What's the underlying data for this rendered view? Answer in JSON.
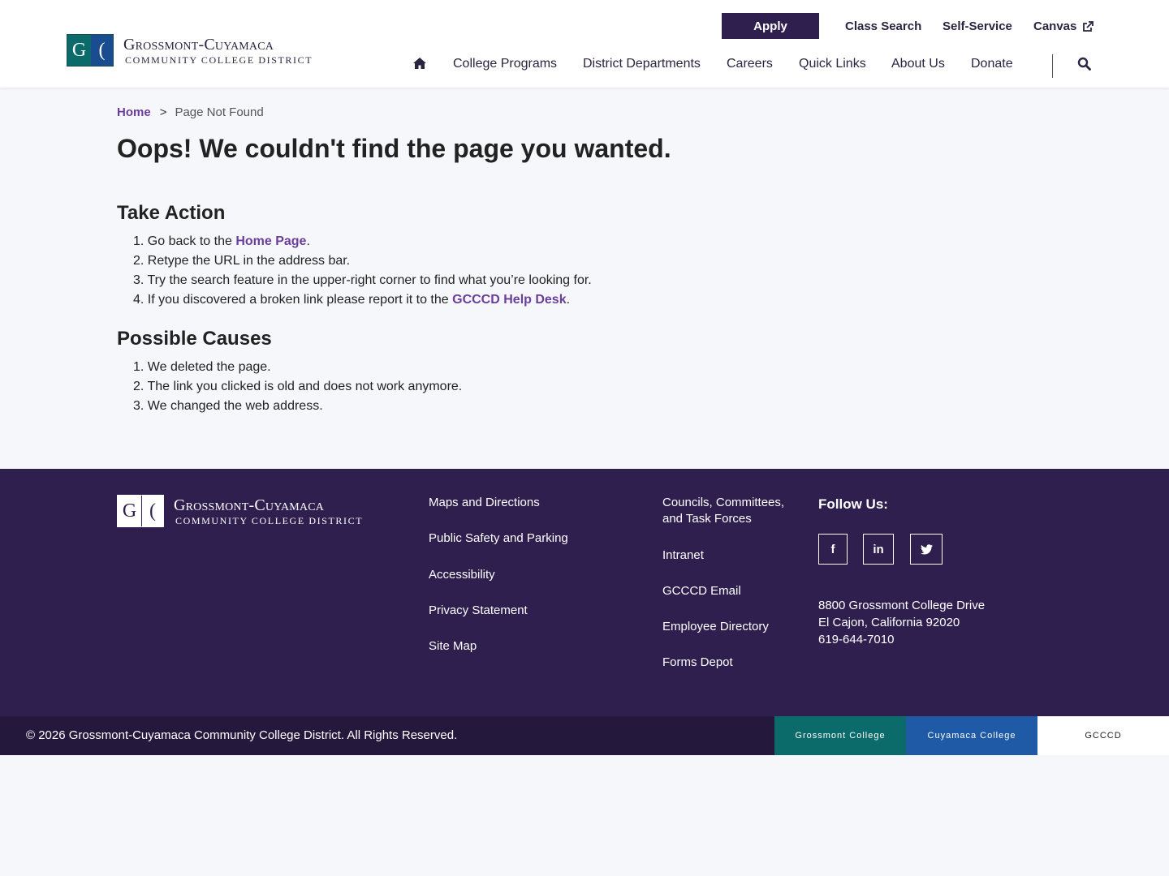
{
  "colors": {
    "brand_purple": "#2e1f4f",
    "link_purple": "#6a3e9a",
    "grossmont_teal": "#0b6a6a",
    "cuyamaca_blue": "#1f5aa6",
    "page_bg": "#f5f7fa"
  },
  "logo": {
    "g": "G",
    "c": "(",
    "name": "Grossmont-Cuyamaca",
    "sub": "COMMUNITY COLLEGE DISTRICT"
  },
  "utility": {
    "apply": "Apply",
    "class_search": "Class Search",
    "self_service": "Self-Service",
    "canvas": "Canvas",
    "canvas_icon": "external-link-icon"
  },
  "nav": {
    "home_icon": "home-icon",
    "items": [
      "College Programs",
      "District Departments",
      "Careers",
      "Quick Links",
      "About Us",
      "Donate"
    ],
    "search_icon": "search-icon"
  },
  "breadcrumb": {
    "home": "Home",
    "separator": ">",
    "current": "Page Not Found"
  },
  "main": {
    "title": "Oops! We couldn't find the page you wanted.",
    "take_action": {
      "heading": "Take Action",
      "items": [
        {
          "num": "1.",
          "before": "Go back to the ",
          "link": "Home Page",
          "after": "."
        },
        {
          "num": "2.",
          "text": "Retype the URL in the address bar."
        },
        {
          "num": "3.",
          "text": "Try the search feature in the upper-right corner to find what you’re looking for."
        },
        {
          "num": "4.",
          "before": "If you discovered a broken link please report it to the ",
          "link": "GCCCD Help Desk",
          "after": "."
        }
      ]
    },
    "possible_causes": {
      "heading": "Possible Causes",
      "items": [
        {
          "num": "1.",
          "text": "We deleted the page."
        },
        {
          "num": "2.",
          "text": "The link you clicked is old and does not work anymore."
        },
        {
          "num": "3.",
          "text": "We changed the web address."
        }
      ]
    }
  },
  "footer": {
    "col1": [
      "Maps and Directions",
      "Public Safety and Parking",
      "Accessibility",
      "Privacy Statement",
      "Site Map"
    ],
    "col2": [
      "Councils, Committees, and Task Forces",
      "Intranet",
      "GCCCD Email",
      "Employee Directory",
      "Forms Depot"
    ],
    "follow_us": "Follow Us:",
    "social": {
      "facebook": "f",
      "linkedin": "in"
    },
    "address": [
      "8800 Grossmont College Drive",
      "El Cajon, California 92020",
      "619-644-7010"
    ],
    "copyright": "© 2026 Grossmont-Cuyamaca Community College District. All Rights Reserved.",
    "tabs": [
      "Grossmont College",
      "Cuyamaca College",
      "GCCCD"
    ]
  }
}
